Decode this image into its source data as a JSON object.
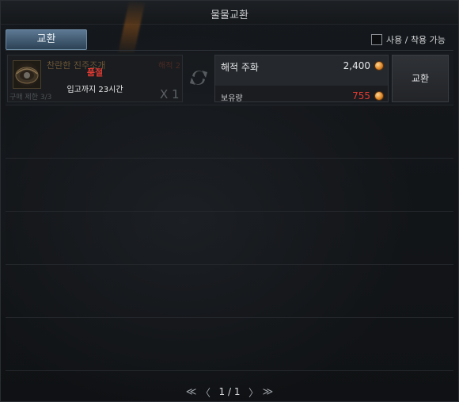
{
  "window": {
    "title": "물물교환"
  },
  "tabs": [
    {
      "label": "교환"
    }
  ],
  "filter": {
    "label": "사용 / 착용 가능",
    "checked": false
  },
  "rows": [
    {
      "item_name": "찬란한 진주조개",
      "item_price_hint": "해적 2",
      "purchase_limit": "구매 제한 3/3",
      "quantity": "X 1",
      "status": "품절",
      "restock": "입고까지 23시간",
      "cost_name": "해적 주화",
      "cost_amount": "2,400",
      "owned_label": "보유량",
      "owned_amount": "755",
      "exchange_label": "교환"
    }
  ],
  "pager": {
    "first": "≪",
    "prev": "〈",
    "page": "1 / 1",
    "next": "〉",
    "last": "≫"
  },
  "icons": {
    "item": "clam-shell-icon",
    "swap": "swap-icon",
    "coin": "pirate-coin-icon"
  },
  "colors": {
    "tab_active": "#4a6580",
    "soldout": "#e23b33",
    "owned_insufficient": "#e03a32",
    "coin": "#e0882a"
  }
}
